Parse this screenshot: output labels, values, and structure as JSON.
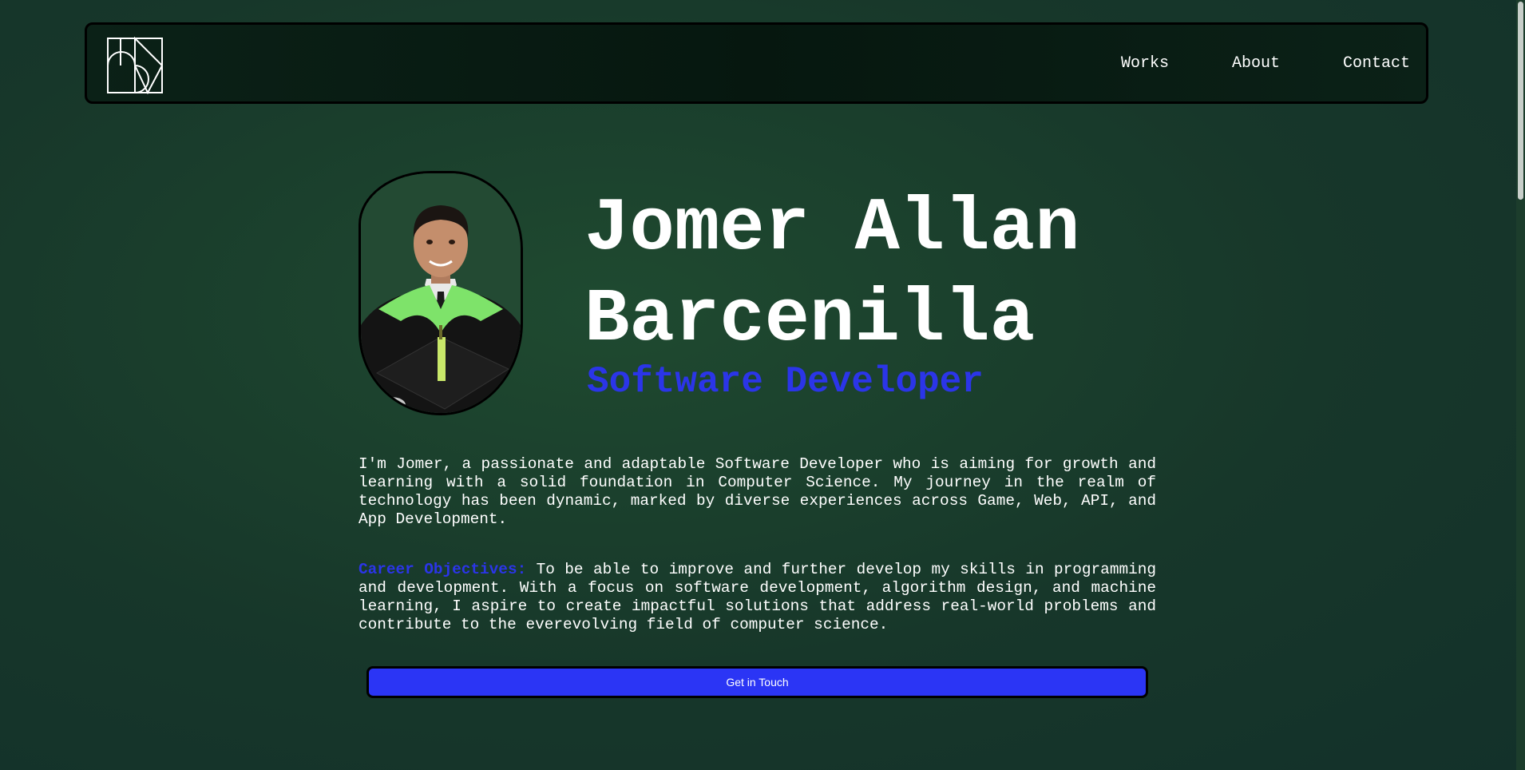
{
  "nav": {
    "logo_icon": "monogram-logo-icon",
    "links": [
      {
        "label": "Works"
      },
      {
        "label": "About"
      },
      {
        "label": "Contact"
      }
    ]
  },
  "hero": {
    "avatar_icon": "profile-photo",
    "name": "Jomer Allan Barcenilla",
    "role": "Software Developer"
  },
  "bio": {
    "text": "I'm Jomer, a passionate and adaptable Software Developer who is aiming for growth and learning with a solid foundation in Computer Science. My journey in the realm of technology has been dynamic, marked by diverse experiences across Game, Web, API, and App Development."
  },
  "objectives": {
    "label": "Career Objectives:",
    "text": "To be able to improve and further develop my skills in programming and development. With a focus on software development, algorithm design, and machine learning, I aspire to create impactful solutions that address real-world problems and contribute to the everevolving field of computer science."
  },
  "cta": {
    "label": "Get in Touch"
  },
  "colors": {
    "accent": "#2b35e8",
    "button": "#2b35f5",
    "background": "#17372a",
    "navbar": "#06170f"
  }
}
